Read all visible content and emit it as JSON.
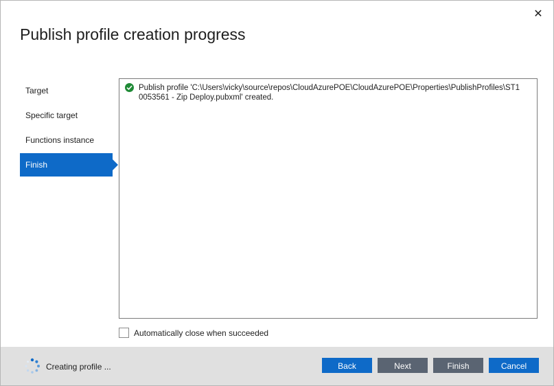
{
  "window": {
    "title": "Publish profile creation progress",
    "close_glyph": "✕"
  },
  "sidebar": {
    "items": [
      {
        "label": "Target"
      },
      {
        "label": "Specific target"
      },
      {
        "label": "Functions instance"
      },
      {
        "label": "Finish",
        "active": true
      }
    ]
  },
  "log": {
    "entries": [
      {
        "icon": "success-check-icon",
        "text": "Publish profile 'C:\\Users\\vicky\\source\\repos\\CloudAzurePOE\\CloudAzurePOE\\Properties\\PublishProfiles\\ST10053561 - Zip Deploy.pubxml' created."
      }
    ]
  },
  "options": {
    "auto_close_label": "Automatically close when succeeded",
    "auto_close_checked": false
  },
  "footer": {
    "status_text": "Creating profile ...",
    "buttons": {
      "back": "Back",
      "next": "Next",
      "finish": "Finish",
      "cancel": "Cancel"
    }
  },
  "colors": {
    "accent": "#0e6ac8",
    "success": "#1f8a36",
    "footer_bg": "#e0e0e0",
    "secondary_button": "#5a6472"
  }
}
